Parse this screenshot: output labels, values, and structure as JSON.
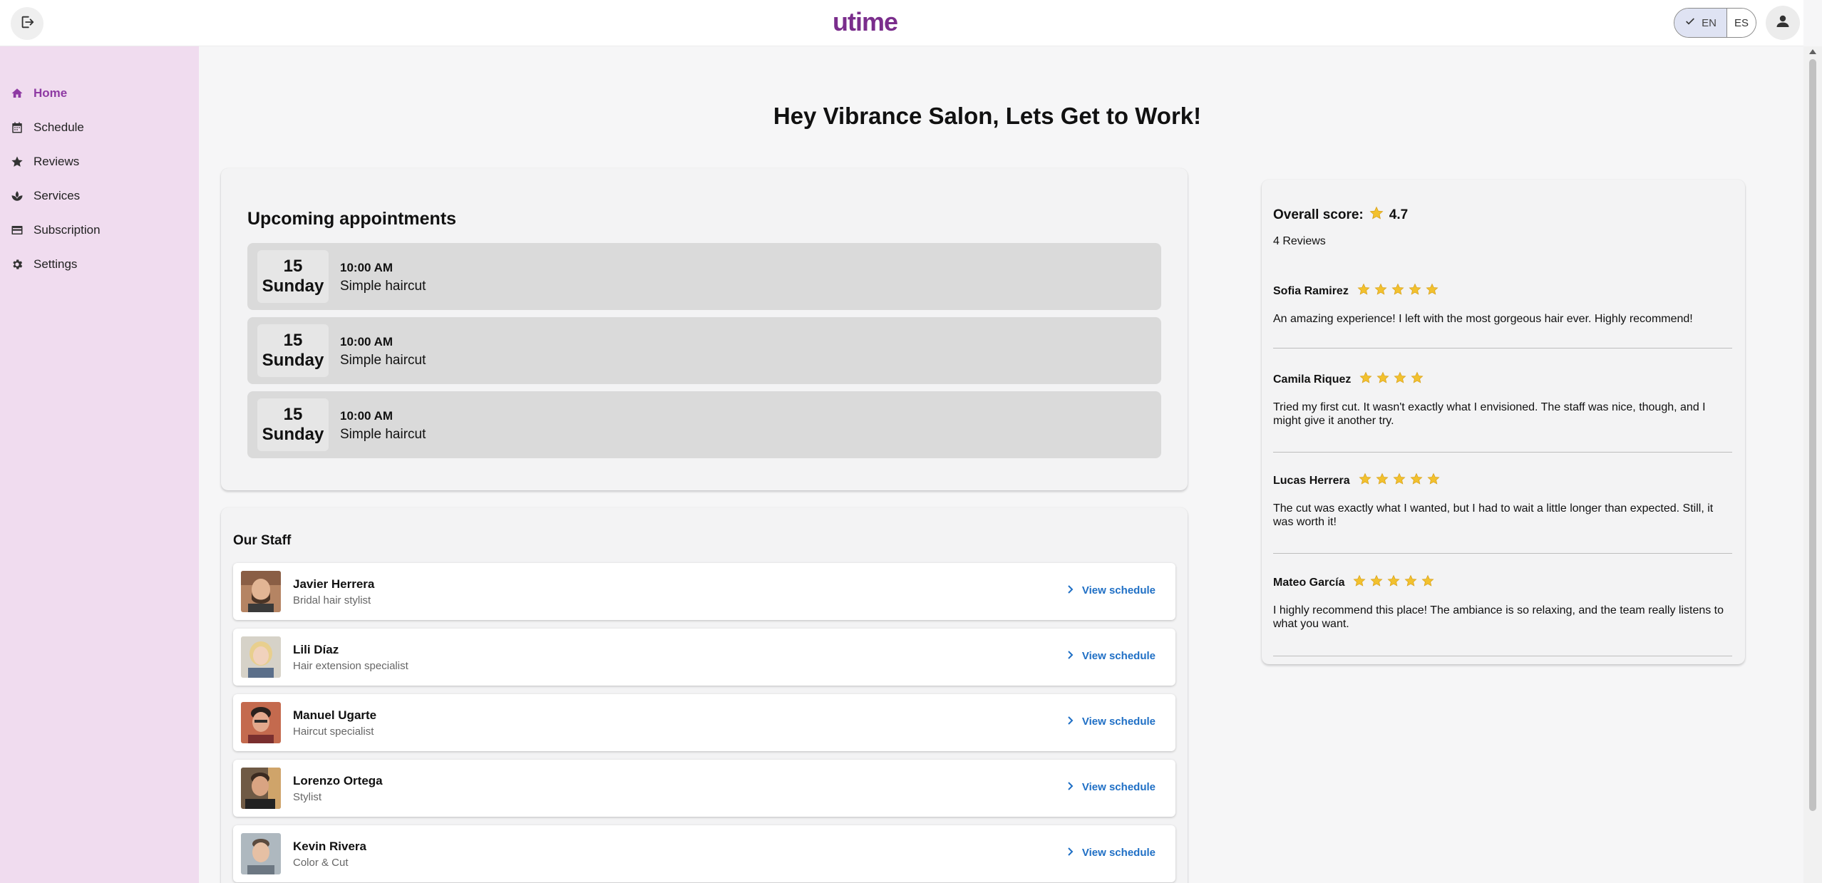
{
  "header": {
    "logo_text": "utime",
    "lang_en": "EN",
    "lang_es": "ES"
  },
  "sidebar": {
    "items": [
      {
        "label": "Home",
        "icon": "home-icon",
        "active": true
      },
      {
        "label": "Schedule",
        "icon": "calendar-icon",
        "active": false
      },
      {
        "label": "Reviews",
        "icon": "star-icon",
        "active": false
      },
      {
        "label": "Services",
        "icon": "spa-icon",
        "active": false
      },
      {
        "label": "Subscription",
        "icon": "credit-card-icon",
        "active": false
      },
      {
        "label": "Settings",
        "icon": "gear-icon",
        "active": false
      }
    ]
  },
  "main": {
    "greeting": "Hey Vibrance Salon, Lets Get to Work!",
    "appointments": {
      "title": "Upcoming appointments",
      "items": [
        {
          "day_num": "15",
          "day_name": "Sunday",
          "time": "10:00 AM",
          "service": "Simple haircut"
        },
        {
          "day_num": "15",
          "day_name": "Sunday",
          "time": "10:00 AM",
          "service": "Simple haircut"
        },
        {
          "day_num": "15",
          "day_name": "Sunday",
          "time": "10:00 AM",
          "service": "Simple haircut"
        }
      ]
    },
    "staff": {
      "title": "Our Staff",
      "view_label": "View schedule",
      "members": [
        {
          "name": "Javier Herrera",
          "role": "Bridal hair stylist"
        },
        {
          "name": "Lili Díaz",
          "role": "Hair extension specialist"
        },
        {
          "name": "Manuel Ugarte",
          "role": "Haircut specialist"
        },
        {
          "name": "Lorenzo Ortega",
          "role": "Stylist"
        },
        {
          "name": "Kevin Rivera",
          "role": "Color & Cut"
        }
      ]
    },
    "reviews": {
      "overall_label": "Overall score:",
      "overall_score": "4.7",
      "count_label": "4 Reviews",
      "items": [
        {
          "name": "Sofia Ramirez",
          "stars": 5,
          "text": "An amazing experience! I left with the most gorgeous hair ever. Highly recommend!"
        },
        {
          "name": "Camila Riquez",
          "stars": 4,
          "text": "Tried my first cut. It wasn't exactly what I envisioned. The staff was nice, though, and I might give it another try."
        },
        {
          "name": "Lucas Herrera",
          "stars": 5,
          "text": "The cut was exactly what I wanted, but I had to wait a little longer than expected. Still, it was worth it!"
        },
        {
          "name": "Mateo García",
          "stars": 5,
          "text": "I highly recommend this place! The ambiance is so relaxing, and the team really listens to what you want."
        }
      ]
    }
  },
  "colors": {
    "brand": "#8e3aa3",
    "sidebar_bg": "#f0dcef",
    "link": "#1f6fc5",
    "star": "#f2c12e"
  }
}
